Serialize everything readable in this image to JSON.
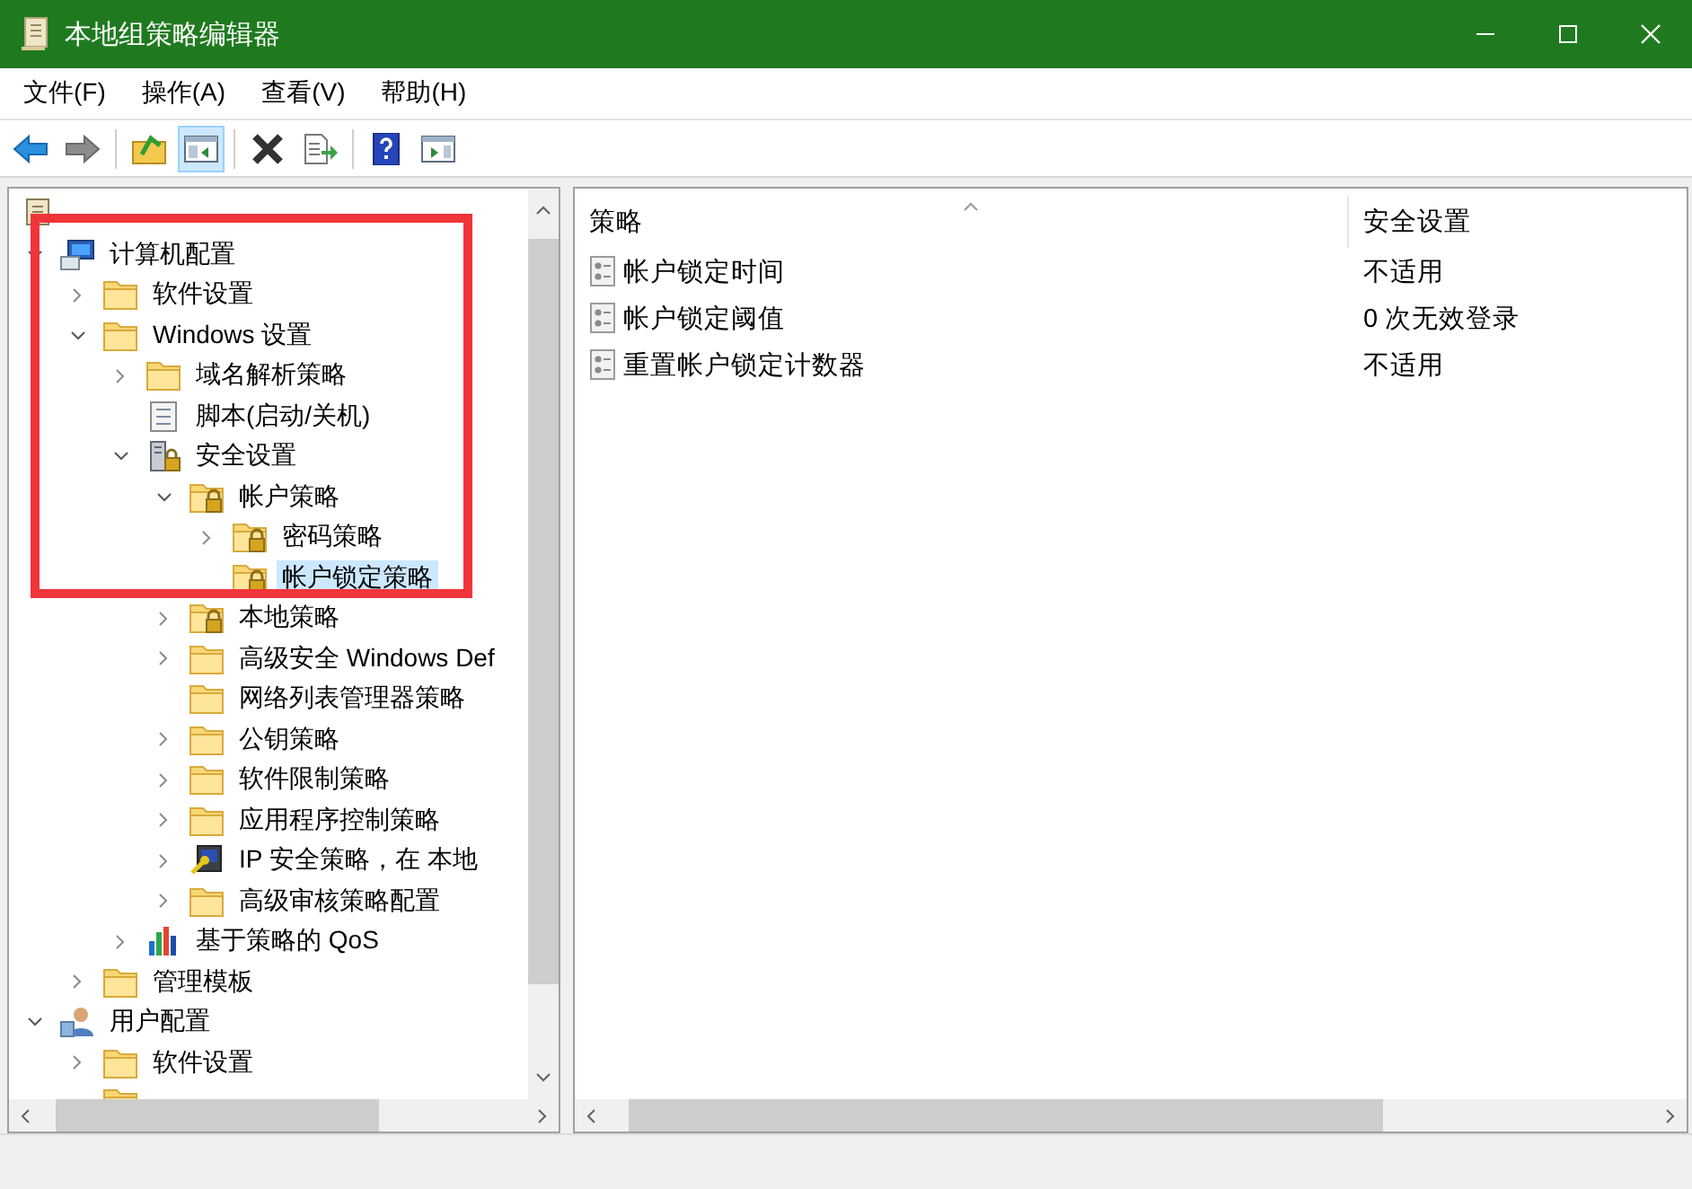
{
  "window": {
    "title": "本地组策略编辑器"
  },
  "menu": [
    "文件(F)",
    "操作(A)",
    "查看(V)",
    "帮助(H)"
  ],
  "toolbar": [
    {
      "kind": "back",
      "pressed": false
    },
    {
      "kind": "forward",
      "pressed": false
    },
    {
      "kind": "separator"
    },
    {
      "kind": "up",
      "pressed": false
    },
    {
      "kind": "show-tree",
      "pressed": true
    },
    {
      "kind": "separator"
    },
    {
      "kind": "delete",
      "pressed": false
    },
    {
      "kind": "export",
      "pressed": false
    },
    {
      "kind": "separator"
    },
    {
      "kind": "help",
      "pressed": false
    },
    {
      "kind": "show-action",
      "pressed": false
    }
  ],
  "tree": [
    {
      "kind": "policy",
      "children": [
        {
          "label": "计算机配置",
          "kind": "computer",
          "expanded": true,
          "selected": false,
          "children": [
            {
              "label": "软件设置",
              "kind": "folder",
              "expanded": false,
              "selected": false
            },
            {
              "label": "Windows 设置",
              "kind": "folder",
              "expanded": true,
              "selected": false,
              "children": [
                {
                  "label": "域名解析策略",
                  "kind": "folder",
                  "expanded": false,
                  "selected": false
                },
                {
                  "label": "脚本(启动/关机)",
                  "kind": "script",
                  "selected": false
                },
                {
                  "label": "安全设置",
                  "kind": "security",
                  "expanded": true,
                  "selected": false,
                  "children": [
                    {
                      "label": "帐户策略",
                      "kind": "lock-folder",
                      "expanded": true,
                      "selected": false,
                      "children": [
                        {
                          "label": "密码策略",
                          "kind": "lock-folder",
                          "expanded": false,
                          "selected": false
                        },
                        {
                          "label": "帐户锁定策略",
                          "kind": "lock-folder",
                          "selected": true
                        }
                      ]
                    },
                    {
                      "label": "本地策略",
                      "kind": "lock-folder",
                      "expanded": false,
                      "selected": false
                    },
                    {
                      "label": "高级安全 Windows Def",
                      "kind": "folder",
                      "expanded": false,
                      "selected": false
                    },
                    {
                      "label": "网络列表管理器策略",
                      "kind": "folder",
                      "selected": false
                    },
                    {
                      "label": "公钥策略",
                      "kind": "folder",
                      "expanded": false,
                      "selected": false
                    },
                    {
                      "label": "软件限制策略",
                      "kind": "folder",
                      "expanded": false,
                      "selected": false
                    },
                    {
                      "label": "应用程序控制策略",
                      "kind": "folder",
                      "expanded": false,
                      "selected": false
                    },
                    {
                      "label": "IP 安全策略，在 本地",
                      "kind": "ip",
                      "expanded": false,
                      "selected": false
                    },
                    {
                      "label": "高级审核策略配置",
                      "kind": "folder",
                      "expanded": false,
                      "selected": false
                    }
                  ]
                },
                {
                  "label": "基于策略的 QoS",
                  "kind": "qos",
                  "expanded": false,
                  "selected": false
                }
              ]
            },
            {
              "label": "管理模板",
              "kind": "folder",
              "expanded": false,
              "selected": false
            }
          ]
        },
        {
          "label": "用户配置",
          "kind": "user",
          "expanded": true,
          "selected": false,
          "children": [
            {
              "label": "软件设置",
              "kind": "folder",
              "expanded": false,
              "selected": false
            },
            {
              "kind": "folder"
            }
          ]
        }
      ]
    }
  ],
  "list": {
    "columns": [
      {
        "label": "策略",
        "sorted": true
      },
      {
        "label": "安全设置",
        "sorted": false
      }
    ],
    "rows": [
      {
        "policy": "帐户锁定时间",
        "setting": "不适用"
      },
      {
        "policy": "帐户锁定阈值",
        "setting": "0 次无效登录"
      },
      {
        "policy": "重置帐户锁定计数器",
        "setting": "不适用"
      }
    ]
  },
  "annotation": {
    "kind": "highlight-rectangle"
  }
}
